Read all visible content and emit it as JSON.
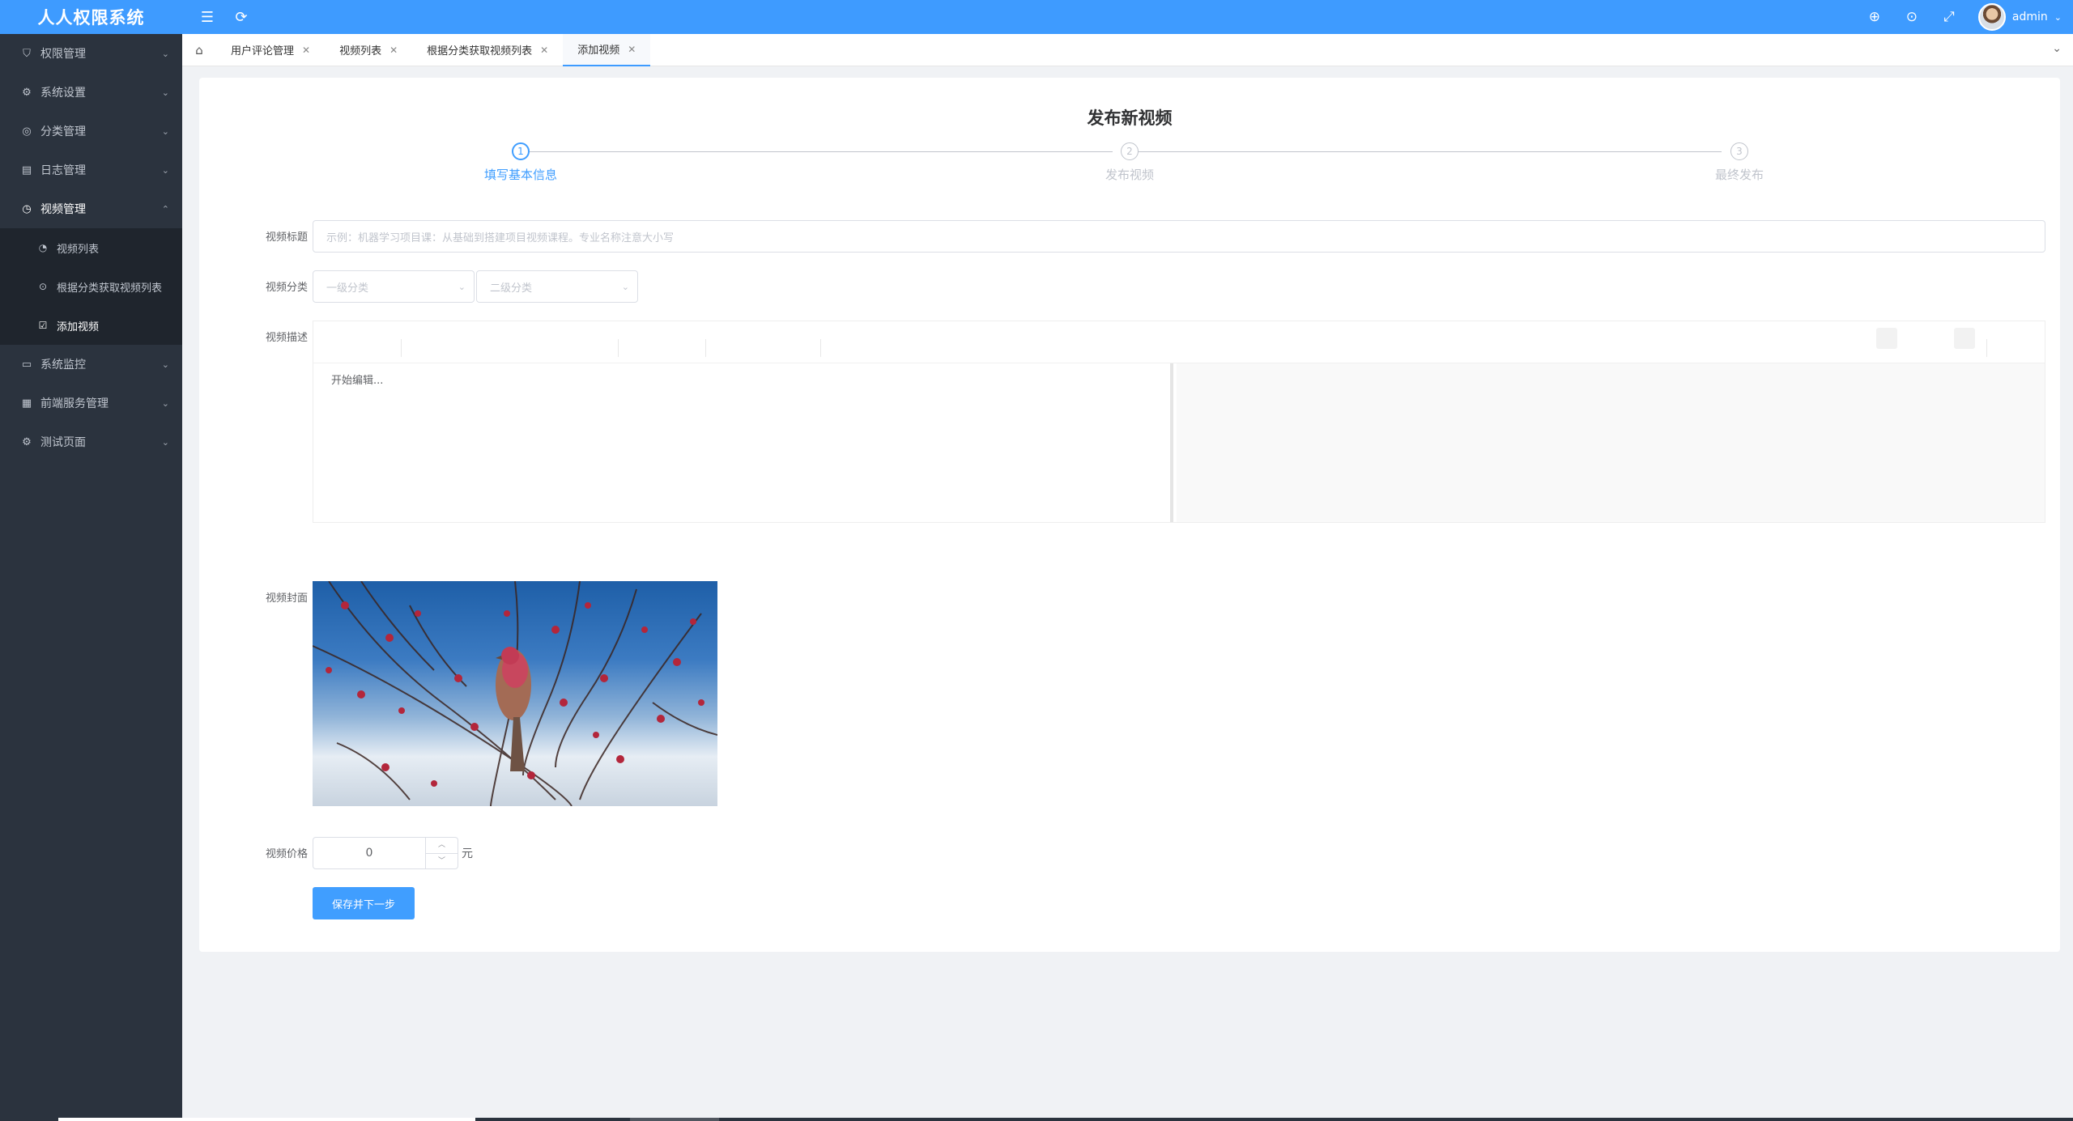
{
  "app": {
    "title": "人人权限系统"
  },
  "header": {
    "user_name": "admin",
    "icons": [
      "menu-fold-icon",
      "refresh-icon",
      "globe-icon",
      "github-icon",
      "fullscreen-icon"
    ]
  },
  "sidebar": {
    "items": [
      {
        "label": "权限管理",
        "icon": "shield-icon"
      },
      {
        "label": "系统设置",
        "icon": "gear-icon"
      },
      {
        "label": "分类管理",
        "icon": "category-icon"
      },
      {
        "label": "日志管理",
        "icon": "log-icon"
      },
      {
        "label": "视频管理",
        "icon": "clock-icon",
        "expanded": true
      }
    ],
    "video_submenu": [
      {
        "label": "视频列表",
        "icon": "list-icon"
      },
      {
        "label": "根据分类获取视频列表",
        "icon": "play-icon"
      },
      {
        "label": "添加视频",
        "icon": "checkbox-icon",
        "active": true
      }
    ],
    "items_after": [
      {
        "label": "系统监控",
        "icon": "monitor-icon"
      },
      {
        "label": "前端服务管理",
        "icon": "grid-icon"
      },
      {
        "label": "测试页面",
        "icon": "settings-icon"
      }
    ]
  },
  "tabs": [
    {
      "label": "用户评论管理"
    },
    {
      "label": "视频列表"
    },
    {
      "label": "根据分类获取视频列表"
    },
    {
      "label": "添加视频",
      "active": true
    }
  ],
  "page": {
    "title": "发布新视频",
    "steps": [
      {
        "num": "1",
        "label": "填写基本信息",
        "active": true
      },
      {
        "num": "2",
        "label": "发布视频"
      },
      {
        "num": "3",
        "label": "最终发布"
      }
    ],
    "form": {
      "title_label": "视频标题",
      "title_placeholder": "示例：机器学习项目课：从基础到搭建项目视频课程。专业名称注意大小写",
      "category_label": "视频分类",
      "category1_placeholder": "一级分类",
      "category2_placeholder": "二级分类",
      "desc_label": "视频描述",
      "desc_placeholder": "开始编辑...",
      "cover_label": "视频封面",
      "price_label": "视频价格",
      "price_value": "0",
      "price_unit": "元",
      "submit_label": "保存并下一步"
    }
  },
  "colors": {
    "header": "#3e9bff",
    "sidebar": "#2b333e",
    "primary": "#409eff"
  }
}
